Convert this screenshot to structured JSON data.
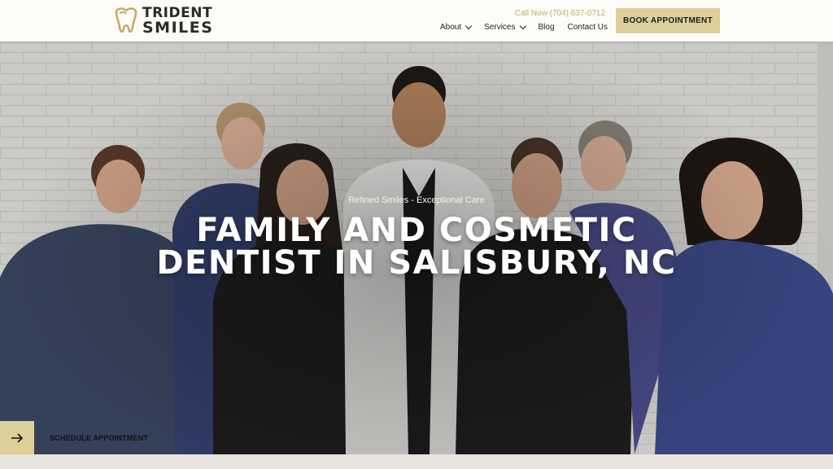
{
  "header": {
    "logo_line1": "TRIDENT",
    "logo_line2": "SMILES",
    "phone": "Call Now (704) 637-0712",
    "nav": [
      {
        "label": "About",
        "dropdown": true
      },
      {
        "label": "Services",
        "dropdown": true
      },
      {
        "label": "Blog",
        "dropdown": false
      },
      {
        "label": "Contact Us",
        "dropdown": false
      }
    ],
    "book_label": "BOOK APPOINTMENT"
  },
  "hero": {
    "tagline": "Refined Smiles - Exceptional Care",
    "headline_line1": "FAMILY AND COSMETIC",
    "headline_line2": "DENTIST IN SALISBURY, NC"
  },
  "schedule": {
    "label": "SCHEDULE APPOINTMENT",
    "icon": "arrow-right-icon"
  },
  "colors": {
    "accent": "#dccf9a",
    "phone": "#c9a86a",
    "header_bg": "#fdfcf8",
    "scrub_navy": "#3d4a82",
    "scrub_black": "#1c1c1c",
    "coat_white": "#f4f4f2"
  }
}
